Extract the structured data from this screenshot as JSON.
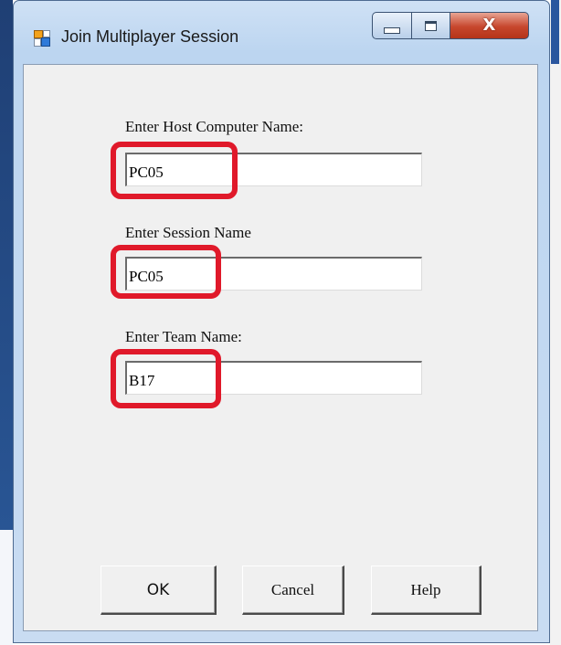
{
  "window": {
    "title": "Join Multiplayer Session",
    "controls": {
      "close_glyph": "X"
    }
  },
  "form": {
    "host_label": "Enter Host Computer Name:",
    "host_value": "PC05",
    "session_label": "Enter Session Name",
    "session_value": "PC05",
    "team_label": "Enter Team Name:",
    "team_value": "B17"
  },
  "buttons": {
    "ok": "OK",
    "cancel": "Cancel",
    "help": "Help"
  },
  "colors": {
    "highlight": "#e0192a",
    "close_button": "#c7472d",
    "dialog_background": "#f0f0f0"
  }
}
